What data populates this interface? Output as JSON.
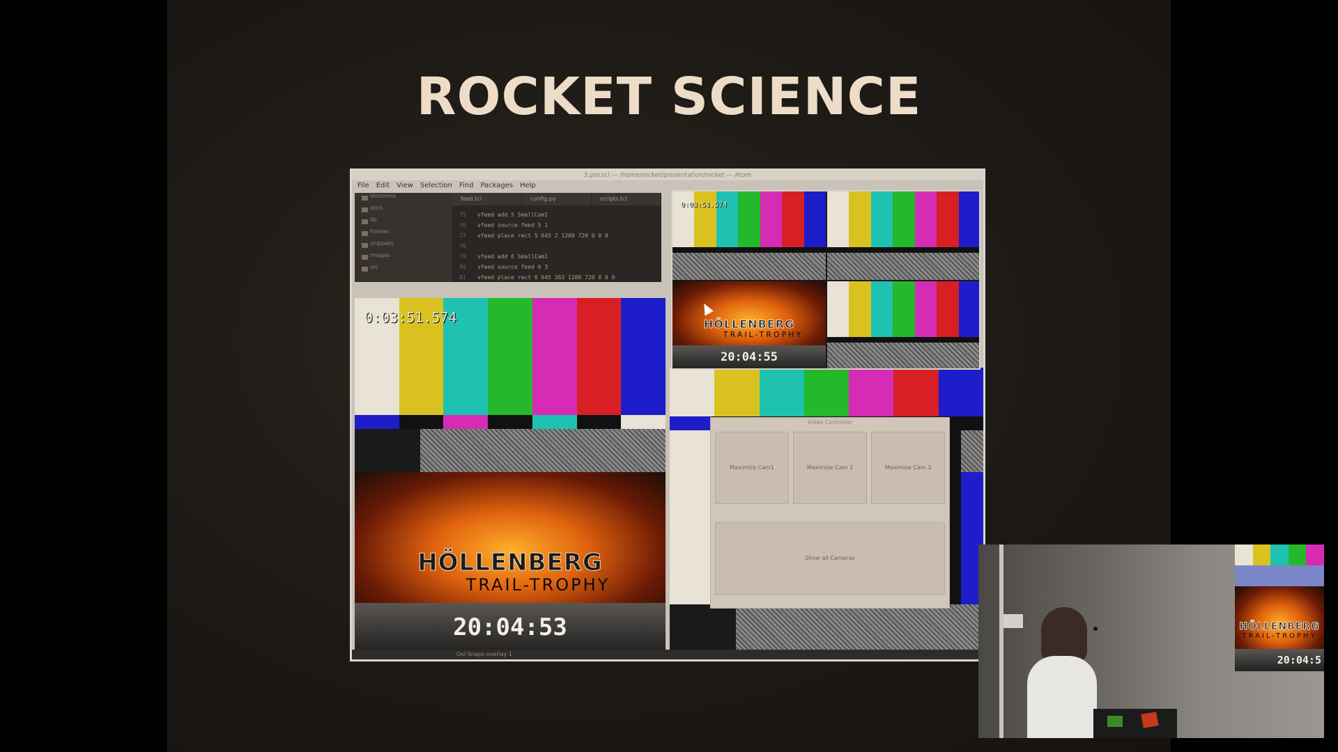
{
  "slide": {
    "title": "ROCKET SCIENCE"
  },
  "editor": {
    "window_title": "3.pro.tcl — /home/rocket/presentation/rocket — Atom",
    "menu": [
      "File",
      "Edit",
      "View",
      "Selection",
      "Find",
      "Packages",
      "Help"
    ],
    "tree": [
      "Voctomix",
      "docs",
      "lib",
      "frames",
      "snippets",
      "images",
      "src"
    ],
    "tabs": [
      "feed.tcl",
      "config.py",
      "scripts.tcl"
    ],
    "code": [
      {
        "ln": "75",
        "text": "vfeed add 5 SmallCam1"
      },
      {
        "ln": "76",
        "text": "vfeed source feed 5 1"
      },
      {
        "ln": "77",
        "text": "vfeed place rect 5 645 2 1280 720 0 0 0"
      },
      {
        "ln": "78",
        "text": ""
      },
      {
        "ln": "79",
        "text": "vfeed add 6 SmallCam1"
      },
      {
        "ln": "80",
        "text": "vfeed source feed 6 3"
      },
      {
        "ln": "81",
        "text": "vfeed place rect 6 645 363 1280 720 0 0 0"
      }
    ],
    "statusbar": "Ovl   Snaps overlay 1"
  },
  "outputs": {
    "main_timecode": "0:03:51.574",
    "quad_timecode": "0:03:51.574",
    "main_clock": "20:04:53",
    "quad_clock": "20:04:55",
    "cam_clock": "20:04:5",
    "logo_main": "HÖLLENBERG",
    "logo_sub": "TRAIL-TROPHY"
  },
  "video_controller": {
    "title": "Video Controller",
    "buttons": [
      "Maximize Cam1",
      "Maximize Cam 2",
      "Maximize Cam 3"
    ],
    "show_all": "Show all Cameras"
  },
  "colors": {
    "bars": [
      "#e9e3d6",
      "#d9c21f",
      "#1fc2b0",
      "#24b82c",
      "#d62bb4",
      "#d81f24",
      "#1d1dc9"
    ],
    "mid": [
      "#1d1dc9",
      "#111111",
      "#d62bb4",
      "#111111",
      "#1fc2b0",
      "#111111",
      "#e9e3d6"
    ],
    "bottom": [
      "#0d1f7a",
      "#f0ebe0",
      "#1b6fb8",
      "#111111",
      "#1a1a1a",
      "#2a2a2a"
    ]
  }
}
